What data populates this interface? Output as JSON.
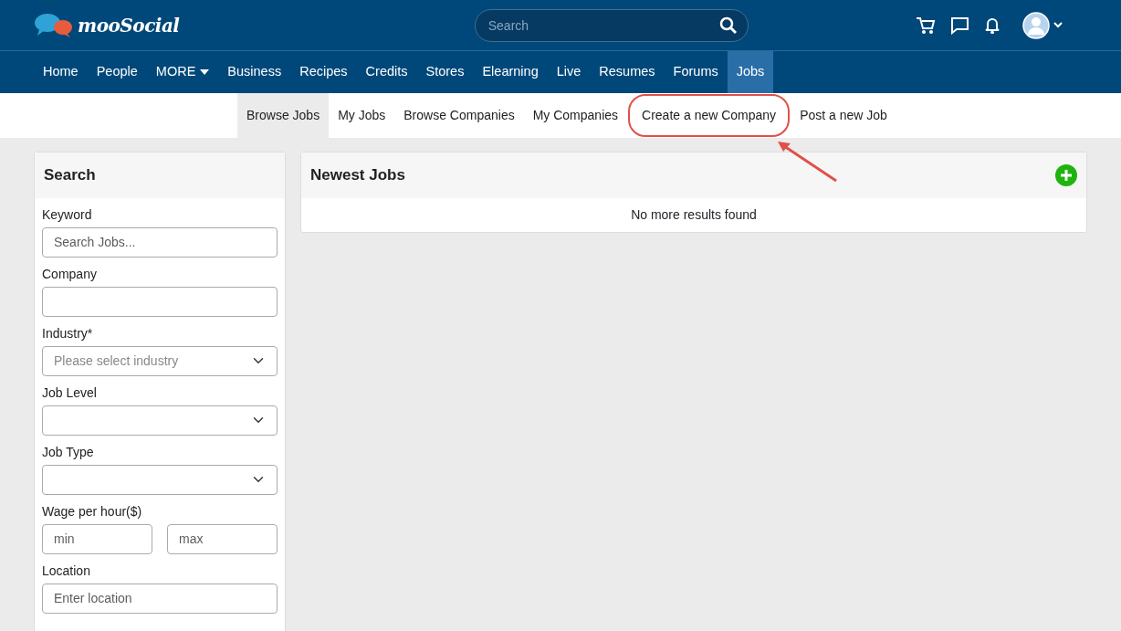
{
  "header": {
    "logo_text": "mooSocial",
    "search": {
      "placeholder": "Search"
    }
  },
  "main_nav": [
    {
      "label": "Home",
      "selected": false,
      "dropdown": false
    },
    {
      "label": "People",
      "selected": false,
      "dropdown": false
    },
    {
      "label": "MORE",
      "selected": false,
      "dropdown": true
    },
    {
      "label": "Business",
      "selected": false,
      "dropdown": false
    },
    {
      "label": "Recipes",
      "selected": false,
      "dropdown": false
    },
    {
      "label": "Credits",
      "selected": false,
      "dropdown": false
    },
    {
      "label": "Stores",
      "selected": false,
      "dropdown": false
    },
    {
      "label": "Elearning",
      "selected": false,
      "dropdown": false
    },
    {
      "label": "Live",
      "selected": false,
      "dropdown": false
    },
    {
      "label": "Resumes",
      "selected": false,
      "dropdown": false
    },
    {
      "label": "Forums",
      "selected": false,
      "dropdown": false
    },
    {
      "label": "Jobs",
      "selected": true,
      "dropdown": false
    }
  ],
  "sub_nav": [
    {
      "label": "Browse Jobs",
      "selected": true,
      "highlighted": false
    },
    {
      "label": "My Jobs",
      "selected": false,
      "highlighted": false
    },
    {
      "label": "Browse Companies",
      "selected": false,
      "highlighted": false
    },
    {
      "label": "My Companies",
      "selected": false,
      "highlighted": false
    },
    {
      "label": "Create a new Company",
      "selected": false,
      "highlighted": true
    },
    {
      "label": "Post a new Job",
      "selected": false,
      "highlighted": false
    }
  ],
  "search_panel": {
    "title": "Search",
    "fields": [
      {
        "kind": "text",
        "label": "Keyword",
        "placeholder": "Search Jobs..."
      },
      {
        "kind": "text",
        "label": "Company"
      },
      {
        "kind": "select",
        "label": "Industry*",
        "placeholder": "Please select industry"
      },
      {
        "kind": "select",
        "label": "Job Level"
      },
      {
        "kind": "select",
        "label": "Job Type"
      },
      {
        "kind": "range",
        "label": "Wage per hour($)",
        "placeholders": [
          "min",
          "max"
        ]
      },
      {
        "kind": "text",
        "label": "Location",
        "placeholder": "Enter location"
      }
    ]
  },
  "newest_jobs": {
    "title": "Newest Jobs",
    "message": "No more results found"
  }
}
